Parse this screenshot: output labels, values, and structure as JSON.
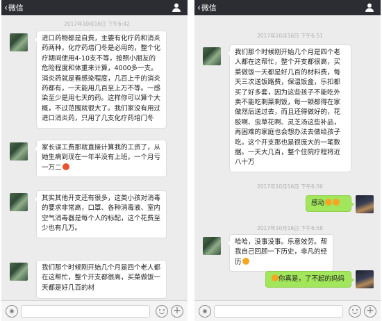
{
  "left": {
    "nav": {
      "back_label": "微信"
    },
    "timestamp": "2017年10月16日 下午6:42",
    "messages": [
      "进口药物都是自费，主要有化疗药和消炎药两种，化疗药培门冬是必用的，整个化疗期间使用4-10支不等，按照小朋友的危险程度和体重来计算，4000多一支。消炎药就是看感染程度，几百上千的消炎药都有，一天能用几百至上万不等。一感染至少是用七天的药。这样你可以算个大概，不过范围就很大了。我们家没有用过进口消炎药，只用了几支化疗药培门冬",
      "家长误工费那就直接计算我的工资了，从她生病到现在一年半没有上班，一个月亏一万二",
      "其实其他开支还有很多，这类小孩对消毒的要求非常高，口罩、各种消毒液、室内空气消毒器是每个人的标配，这个花费至少也有几万。",
      "我们那个时候刚开始几个月是四个老人都在这帮忙，整个开支都很高，买菜做饭一天都是好几百的材"
    ]
  },
  "right": {
    "nav": {
      "back_label": "微信"
    },
    "messages": [
      {
        "type": "timestamp",
        "text": "2017年10月16日 下午6:51"
      },
      {
        "type": "in",
        "text": "我们那个时候刚开始几个月是四个老人都在这帮忙，整个开支都很高，买菜做饭一天都是好几百的材料费，每天三次送饭路费，保温饭盒，乐扣都买了好多套，因为这些孩子不能吃外卖不能吃剩菜剩饭，每一顿都得在家做然后送过去，而且还得做好的，花胶啊、虫草花啊、灵芝汤这些补品，再困难的家庭也会想办法去做给孩子吃。这个开支那也是很庞大的一笔数据。一天大几百，整个住院疗程将近八十万"
      },
      {
        "type": "timestamp",
        "text": "2017年10月16日 下午6:56"
      },
      {
        "type": "out",
        "text": "感动"
      },
      {
        "type": "timestamp",
        "text": "2017年10月16日 下午6:58"
      },
      {
        "type": "in",
        "text": "哈哈，没事没事。乐意效劳。帮我自己回顾一下历史，非凡的经历"
      },
      {
        "type": "out",
        "text": "你真是，了不起的妈妈"
      }
    ]
  },
  "icons": {
    "person": "person-icon",
    "voice": "voice-icon",
    "emoji": "emoji-icon",
    "plus": "plus-icon"
  },
  "colors": {
    "nav_bar": "#2b2d32",
    "chat_bg": "#ececec",
    "incoming_bubble": "#ffffff",
    "outgoing_bubble": "#a2e65b"
  }
}
